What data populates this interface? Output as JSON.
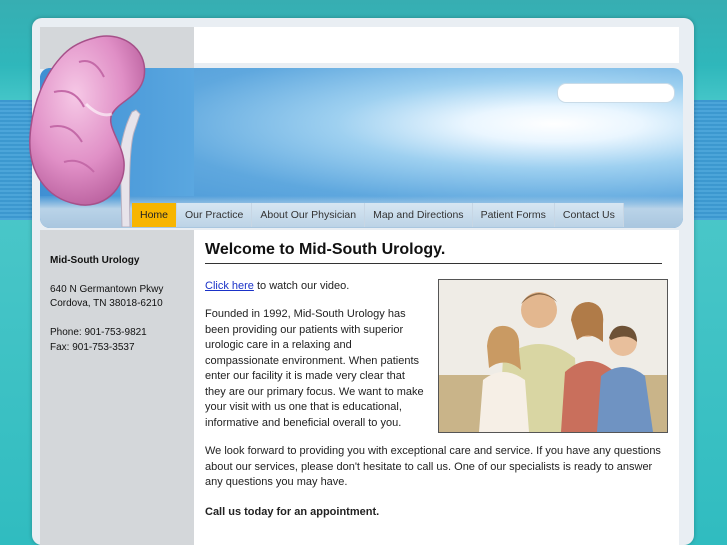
{
  "header": {
    "search_placeholder": ""
  },
  "nav": {
    "items": [
      {
        "label": "Home",
        "active": true
      },
      {
        "label": "Our Practice"
      },
      {
        "label": "About Our Physician"
      },
      {
        "label": "Map and Directions"
      },
      {
        "label": "Patient Forms"
      },
      {
        "label": "Contact Us"
      }
    ]
  },
  "sidebar": {
    "practice_name": "Mid-South Urology",
    "address_line1": "640 N Germantown Pkwy",
    "address_line2": "Cordova, TN 38018-6210",
    "phone": "Phone: 901-753-9821",
    "fax": "Fax: 901-753-3537"
  },
  "main": {
    "heading": "Welcome to Mid-South Urology.",
    "video_link": "Click here",
    "video_text": " to watch our video.",
    "paragraph1": "Founded in 1992, Mid-South Urology has been providing our patients with superior urologic care in a relaxing and compassionate environment. When patients enter our facility it is made very clear that they are our primary focus. We want to make your visit with us one that is educational, informative and beneficial overall to you.",
    "paragraph2": "We look forward to providing you with exceptional care and service. If you have any questions about our services, please don't hesitate to call us. One of our specialists is ready to answer any questions you may have.",
    "call_to_action": "Call us today for an appointment."
  },
  "colors": {
    "nav_active": "#f7b500",
    "link": "#1a32c8",
    "background_teal": "#3fbec1"
  }
}
